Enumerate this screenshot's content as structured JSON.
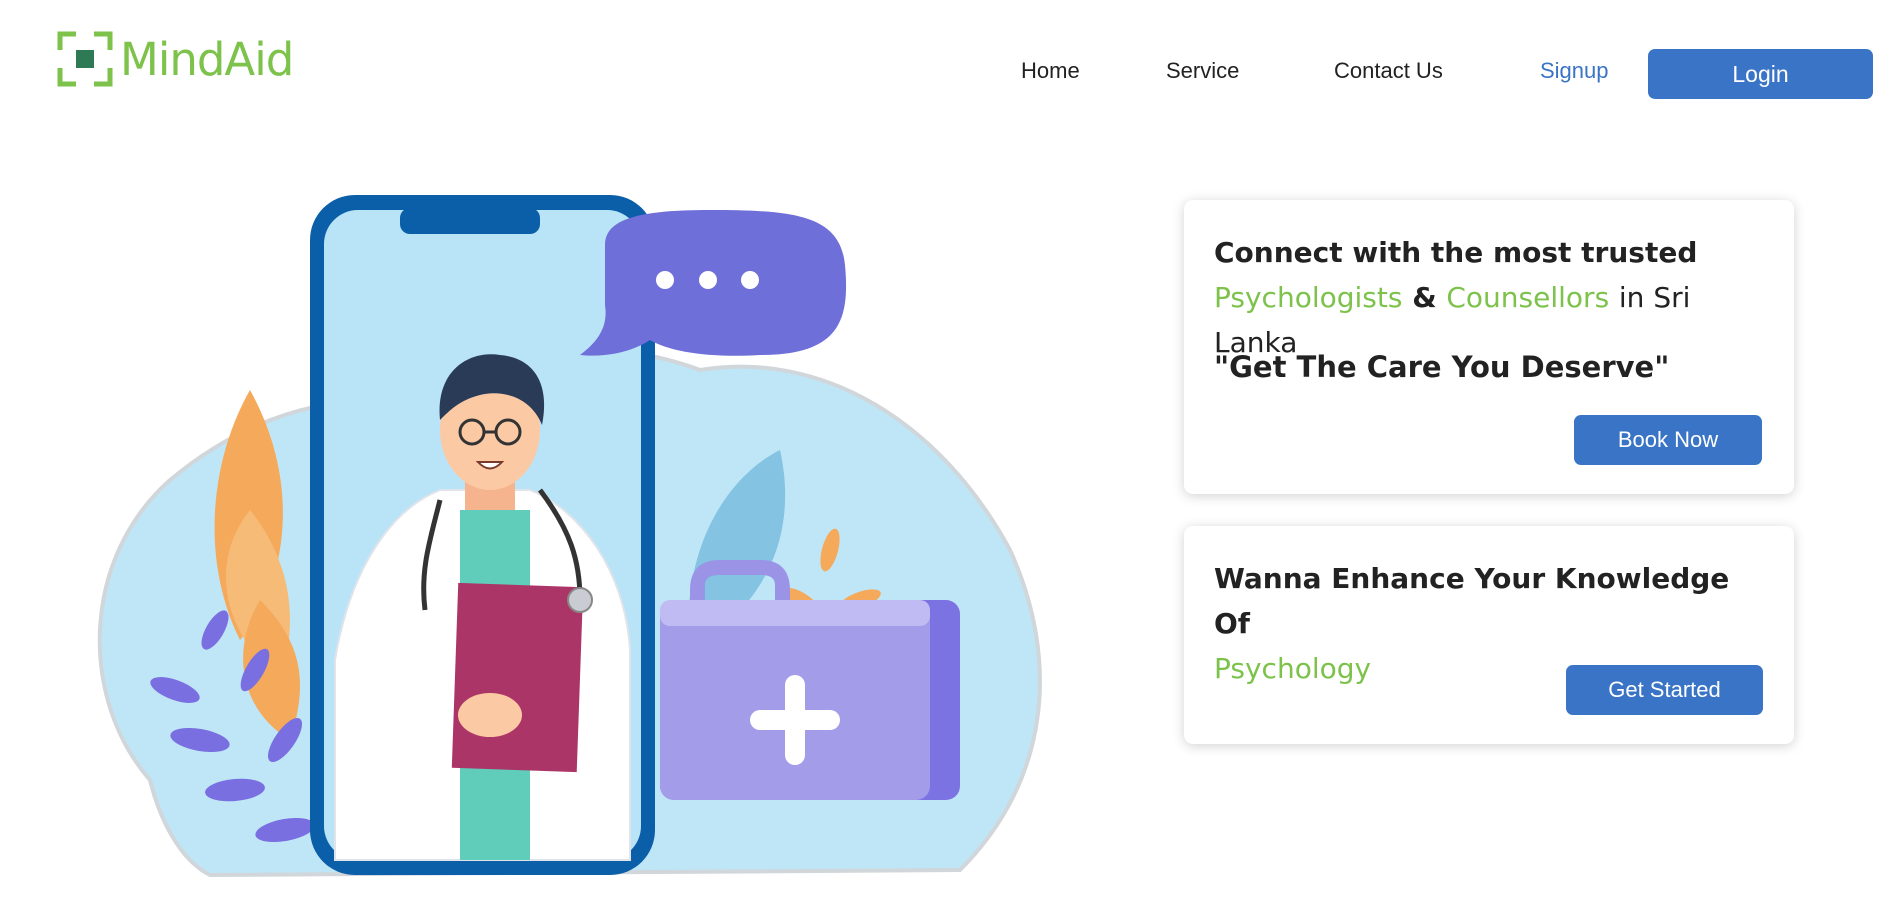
{
  "brand": {
    "name": "MindAid",
    "color": "#7dc24b",
    "icon": "bracket-square-logo-icon"
  },
  "nav": {
    "home": "Home",
    "service": "Service",
    "contact": "Contact Us",
    "signup": "Signup",
    "login": "Login"
  },
  "hero": {
    "illustration": "doctor-on-phone-illustration",
    "chat_icon": "speech-bubble-icon",
    "medkit_icon": "medical-kit-icon"
  },
  "card_connect": {
    "line1": "Connect with the most trusted",
    "word_psychologists": "Psychologists",
    "ampersand": "&",
    "word_counsellors": "Counsellors",
    "suffix": "in Sri Lanka",
    "tagline": "\"Get The Care You Deserve\"",
    "button": "Book Now"
  },
  "card_knowledge": {
    "line1": "Wanna Enhance Your Knowledge Of",
    "word_psychology": "Psychology",
    "button": "Get Started"
  },
  "colors": {
    "primary_blue": "#3a74c6",
    "accent_green": "#7dc24b",
    "text_dark": "#222222"
  }
}
